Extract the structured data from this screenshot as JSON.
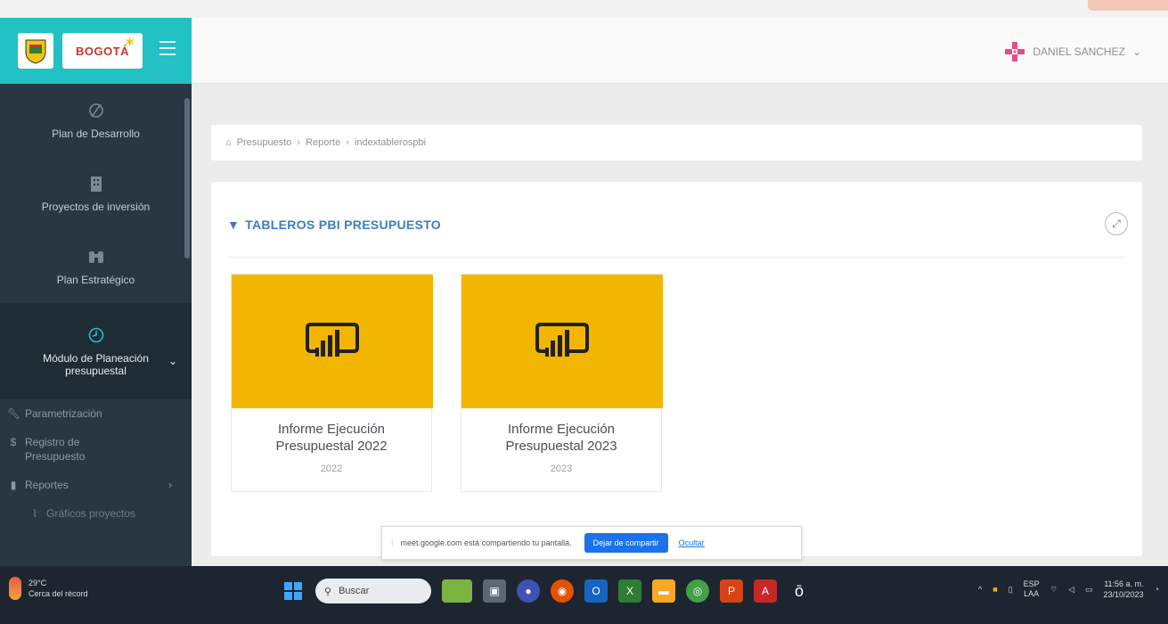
{
  "brand": {
    "logo_text": "BOGOTÁ"
  },
  "sidebar": {
    "items": [
      {
        "label": "Plan de Desarrollo",
        "icon": "circle-slash-icon"
      },
      {
        "label": "Proyectos de inversión",
        "icon": "building-icon"
      },
      {
        "label": "Plan Estratégico",
        "icon": "binoculars-icon"
      },
      {
        "label": "Módulo de Planeación presupuestal",
        "icon": "clock-icon",
        "active": true
      }
    ],
    "subitems": [
      {
        "label": "Parametrización",
        "icon": "wrench-icon"
      },
      {
        "label": "Registro de Presupuesto",
        "icon": "dollar-icon"
      },
      {
        "label": "Reportes",
        "icon": "bar-chart-icon"
      },
      {
        "label": "Gráficos proyectos",
        "icon": "chart-icon"
      }
    ]
  },
  "header": {
    "user_name": "DANIEL SANCHEZ"
  },
  "breadcrumb": [
    "Presupuesto",
    "Reporte",
    "indextablerospbi"
  ],
  "panel": {
    "title": "TABLEROS PBI PRESUPUESTO"
  },
  "cards": [
    {
      "title": "Informe Ejecución Presupuestal 2022",
      "year": "2022"
    },
    {
      "title": "Informe Ejecución Presupuestal 2023",
      "year": "2023"
    }
  ],
  "sharebar": {
    "message": "meet.google.com está compartiendo tu pantalla.",
    "stop_label": "Dejar de compartir",
    "hide_label": "Ocultar"
  },
  "taskbar": {
    "weather_temp": "29°C",
    "weather_desc": "Cerca del récord",
    "search_placeholder": "Buscar",
    "lang_top": "ESP",
    "lang_bottom": "LAA",
    "time": "11:56 a. m.",
    "date": "23/10/2023"
  },
  "colors": {
    "accent_teal": "#22c1c3",
    "sidebar_bg": "#283742",
    "card_yellow": "#f2b600",
    "title_blue": "#3c7fc0"
  }
}
